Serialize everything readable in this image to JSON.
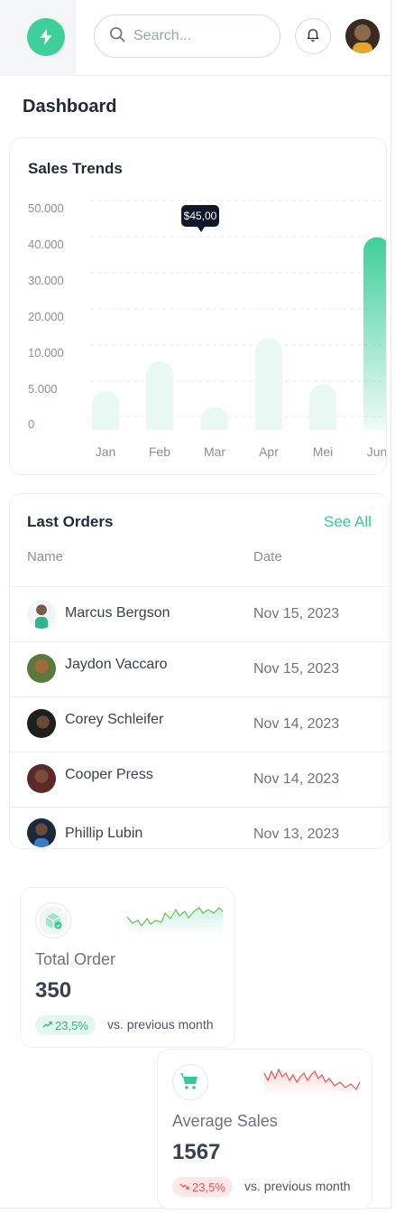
{
  "header": {
    "logo_icon": "lightning-bolt-icon",
    "search_placeholder": "Search...",
    "notification_icon": "bell-icon",
    "accent": "#3ecf9a"
  },
  "page": {
    "title": "Dashboard"
  },
  "sales_trends": {
    "title": "Sales Trends",
    "tooltip": "$45,00"
  },
  "chart_data": {
    "type": "bar",
    "title": "Sales Trends",
    "categories": [
      "Jan",
      "Feb",
      "Mar",
      "Apr",
      "Mei",
      "Jun"
    ],
    "values": [
      8500,
      15000,
      5000,
      20000,
      10000,
      42000
    ],
    "y_ticks": [
      "50.000",
      "40.000",
      "30.000",
      "20.000",
      "10.000",
      "5.000",
      "0"
    ],
    "ylim": [
      0,
      50000
    ],
    "highlight_index": 5,
    "bar_color": "#3ecf9a",
    "grid": "dashed horizontal"
  },
  "orders": {
    "title": "Last Orders",
    "see_all": "See All",
    "columns": {
      "name": "Name",
      "date": "Date"
    },
    "rows": [
      {
        "name": "Marcus Bergson",
        "date": "Nov 15, 2023"
      },
      {
        "name": "Jaydon Vaccaro",
        "date": "Nov 15, 2023"
      },
      {
        "name": "Corey Schleifer",
        "date": "Nov 14, 2023"
      },
      {
        "name": "Cooper Press",
        "date": "Nov 14, 2023"
      },
      {
        "name": "Phillip Lubin",
        "date": "Nov 13, 2023"
      }
    ]
  },
  "stats": {
    "total_order": {
      "icon": "package-box-icon",
      "label": "Total Order",
      "value": "350",
      "change": "23,5%",
      "compare": "vs. previous month",
      "trend": "up",
      "color": "#34c79a"
    },
    "average_sales": {
      "icon": "shopping-cart-icon",
      "label": "Average Sales",
      "value": "1567",
      "change": "23,5%",
      "compare": "vs. previous month",
      "trend": "down",
      "color": "#e25555"
    }
  }
}
